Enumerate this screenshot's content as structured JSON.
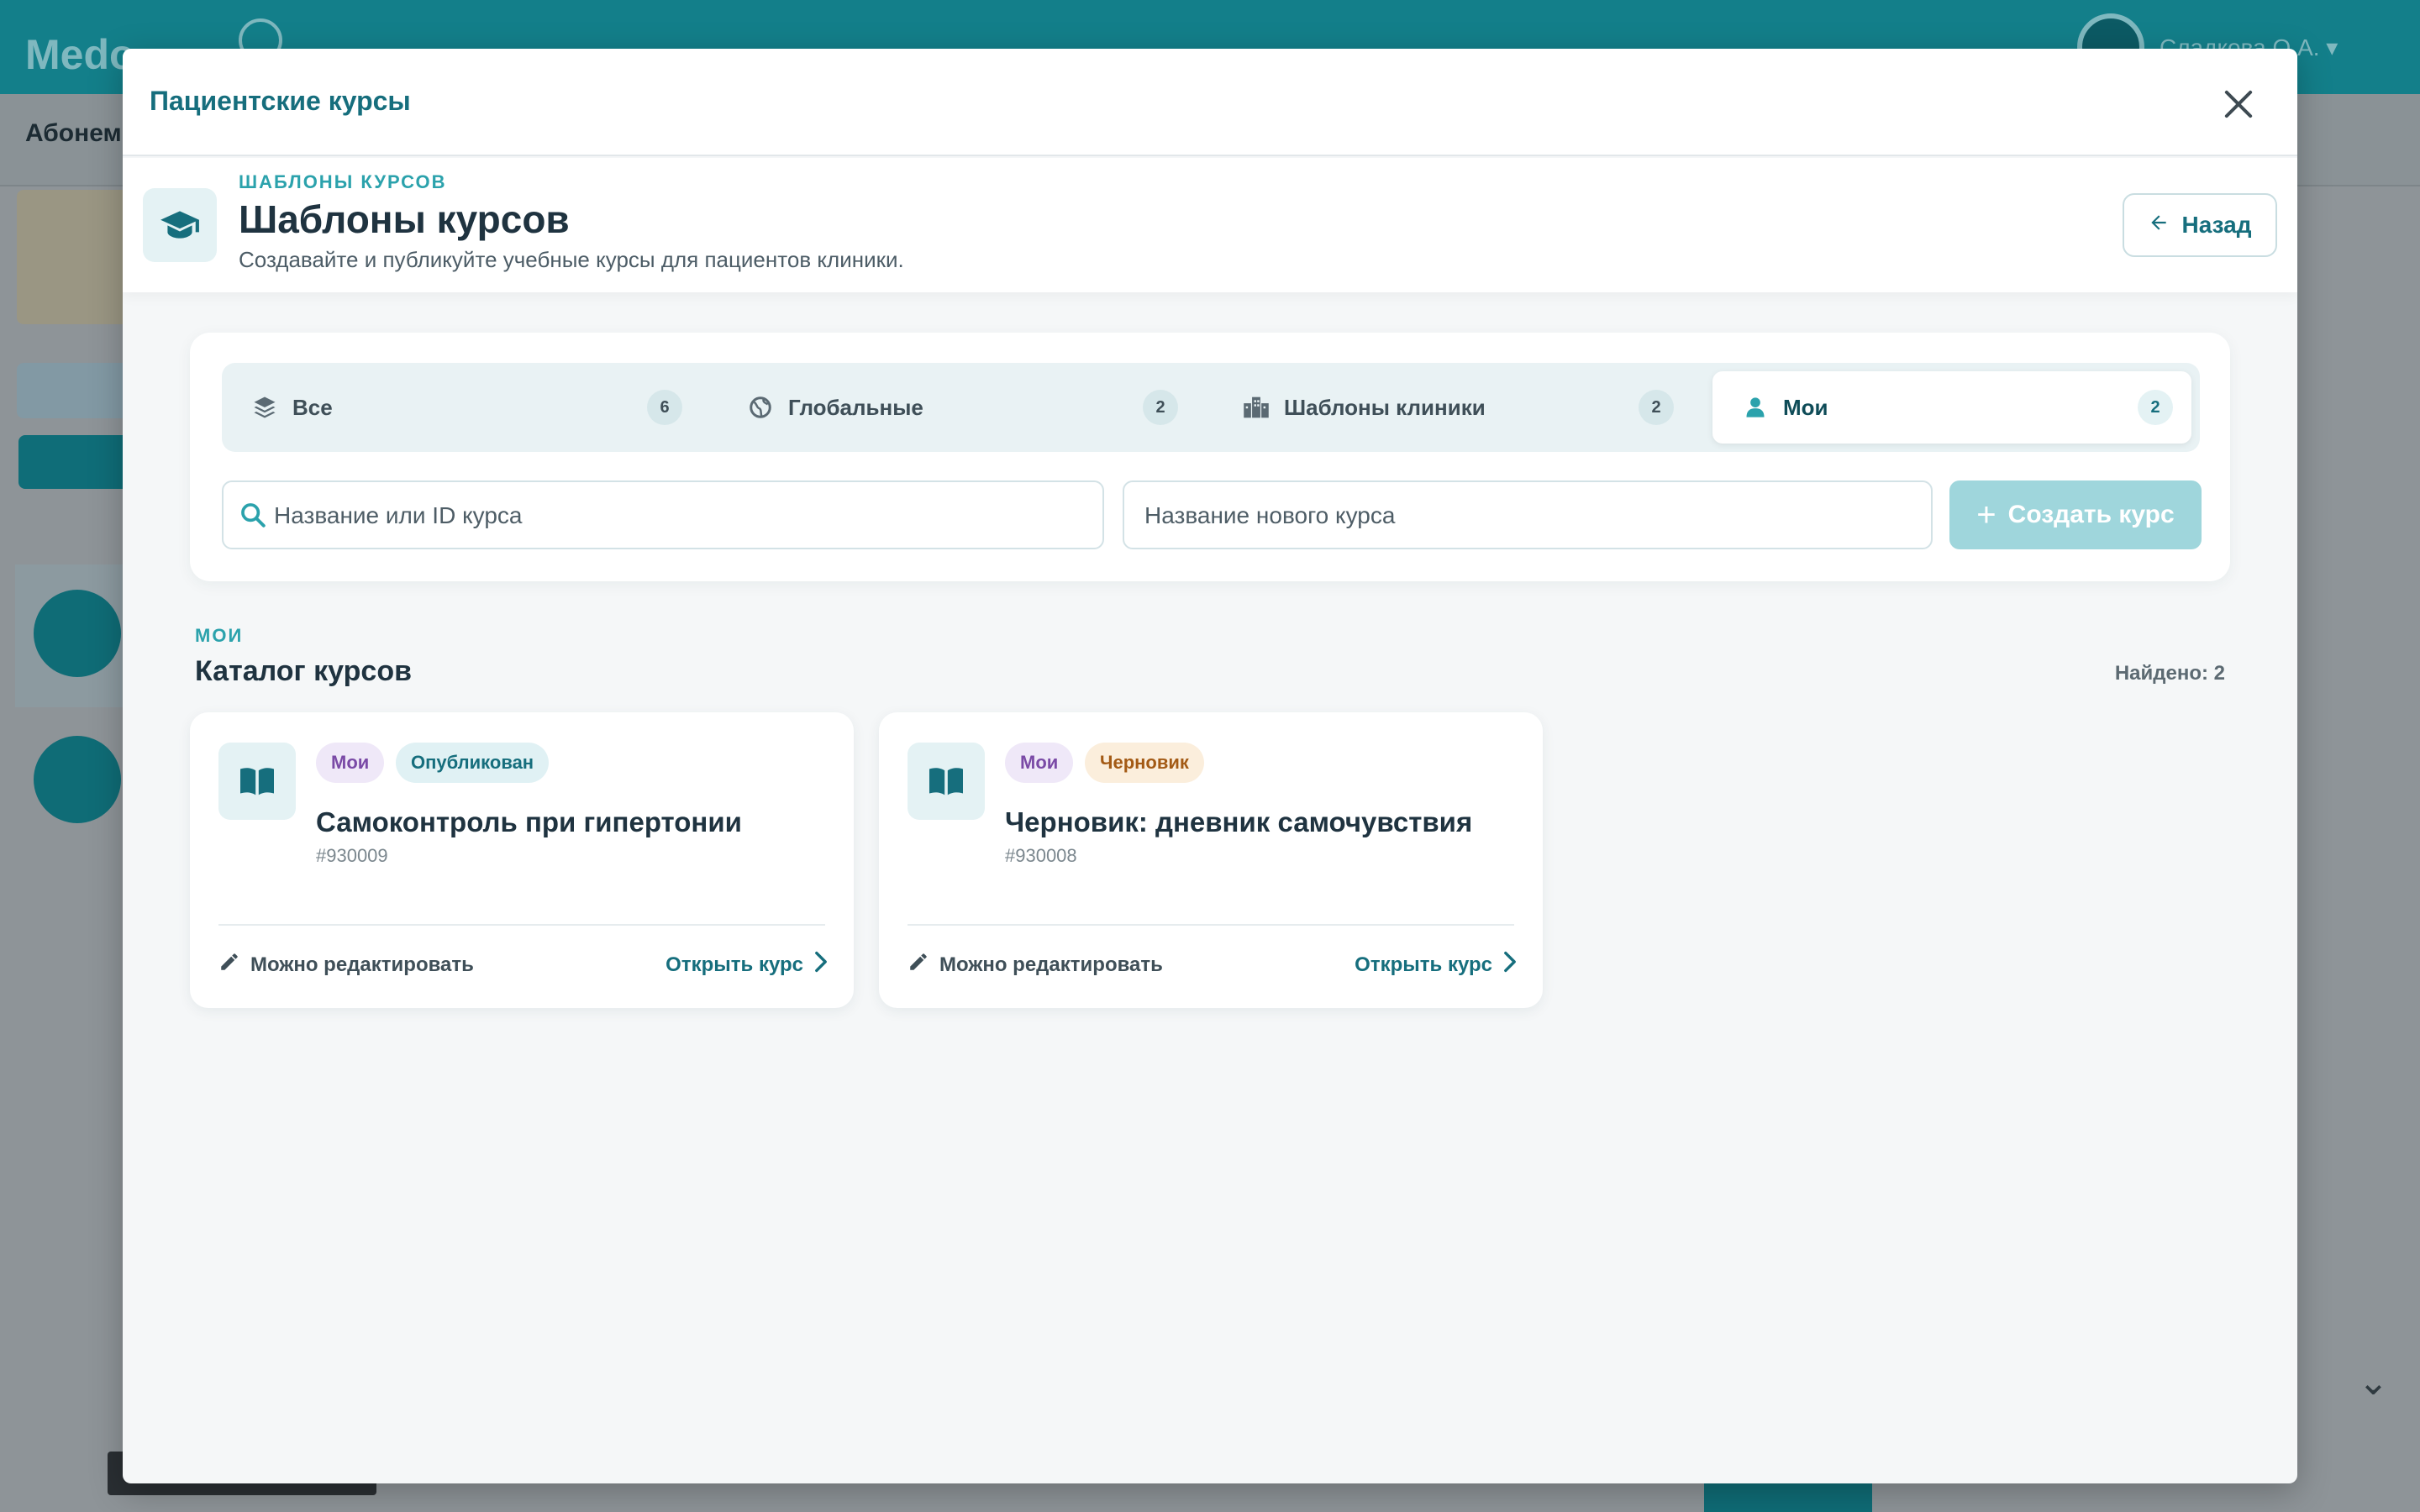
{
  "background": {
    "logo": "Medo",
    "username": "Сладкова О.А. ▾",
    "subbar_text": "Абонем"
  },
  "modal": {
    "title": "Пациентские курсы",
    "close_icon": "close-icon"
  },
  "page_head": {
    "eyebrow": "ШАБЛОНЫ КУРСОВ",
    "title": "Шаблоны курсов",
    "subtitle": "Создавайте и публикуйте учебные курсы для пациентов клиники.",
    "icon": "graduation-cap-icon",
    "back_label": "Назад"
  },
  "tabs": [
    {
      "label": "Все",
      "count": "6",
      "icon": "layers-icon",
      "active": false
    },
    {
      "label": "Глобальные",
      "count": "2",
      "icon": "globe-icon",
      "active": false
    },
    {
      "label": "Шаблоны клиники",
      "count": "2",
      "icon": "building-icon",
      "active": false
    },
    {
      "label": "Мои",
      "count": "2",
      "icon": "user-icon",
      "active": true
    }
  ],
  "search": {
    "value": "",
    "placeholder": "Название или ID курса"
  },
  "new_course": {
    "value": "",
    "placeholder": "Название нового курса",
    "create_label": "Создать курс"
  },
  "section": {
    "eyebrow": "МОИ",
    "title": "Каталог курсов",
    "found": "Найдено: 2"
  },
  "courses": [
    {
      "badges": [
        {
          "label": "Мои",
          "kind": "mine"
        },
        {
          "label": "Опубликован",
          "kind": "published"
        }
      ],
      "title": "Самоконтроль при гипертонии",
      "id": "#930009",
      "edit_label": "Можно редактировать",
      "open_label": "Открыть курс"
    },
    {
      "badges": [
        {
          "label": "Мои",
          "kind": "mine"
        },
        {
          "label": "Черновик",
          "kind": "draft"
        }
      ],
      "title": "Черновик: дневник самочувствия",
      "id": "#930008",
      "edit_label": "Можно редактировать",
      "open_label": "Открыть курс"
    }
  ],
  "colors": {
    "accent": "#166e7d",
    "accent_light": "#2ba2ac",
    "create_button": "#9fd6dc",
    "badge_mine_text": "#7a4aa6",
    "badge_draft_text": "#a35a15"
  }
}
